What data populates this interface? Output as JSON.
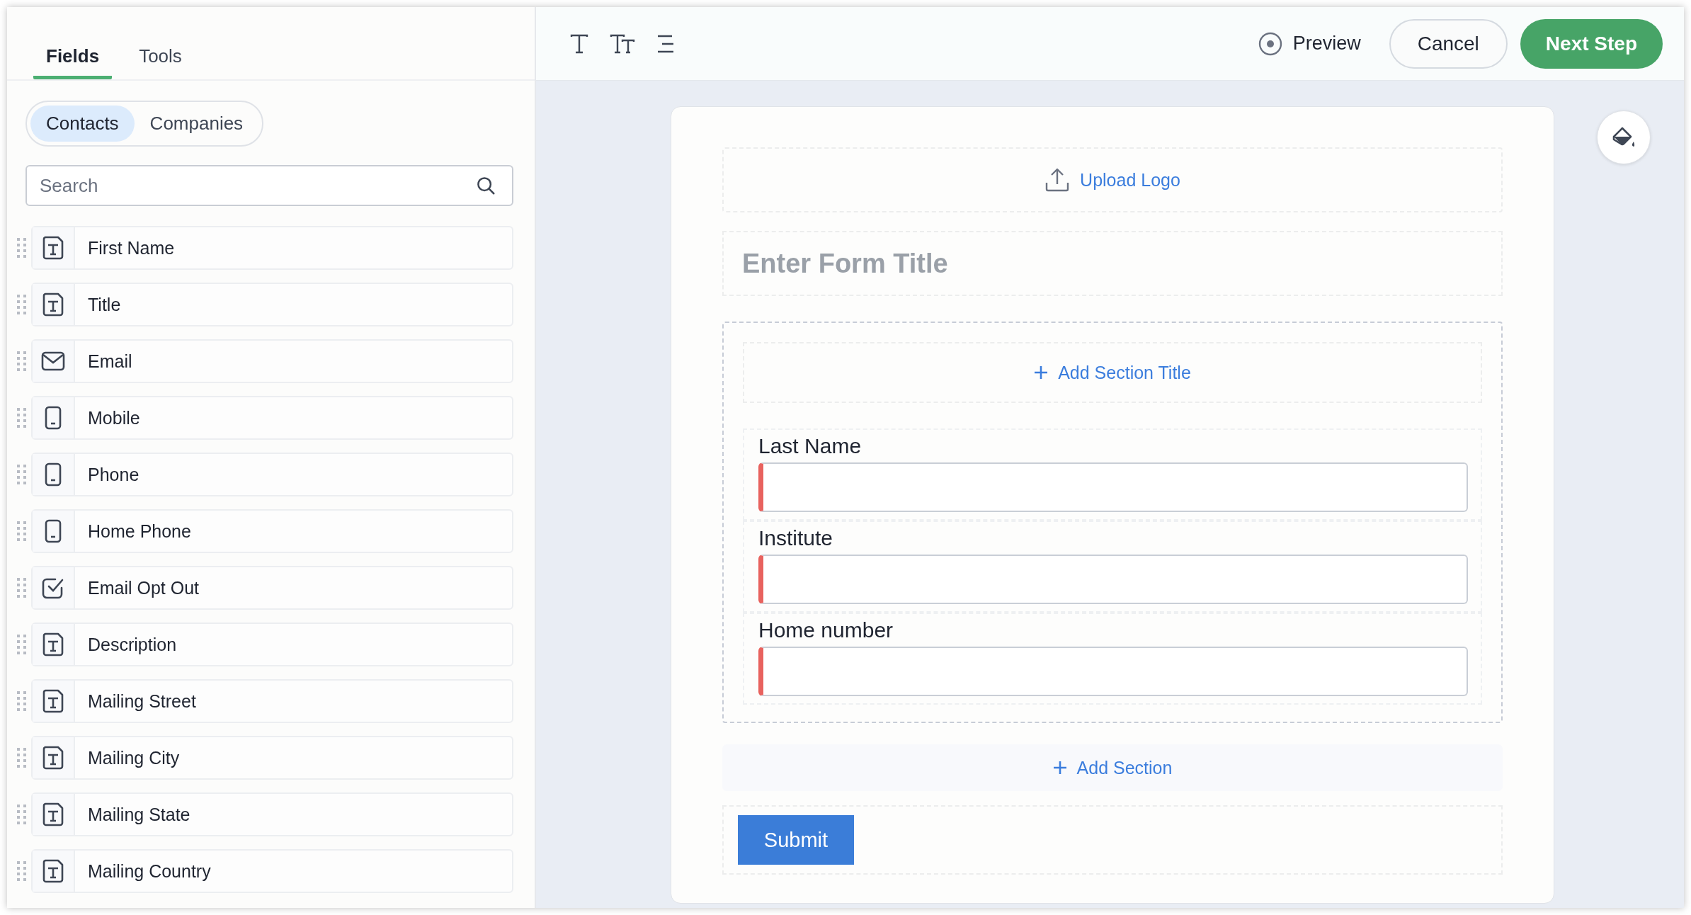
{
  "tabs": [
    {
      "label": "Fields",
      "selected": true
    },
    {
      "label": "Tools",
      "selected": false
    }
  ],
  "segments": [
    {
      "label": "Contacts",
      "selected": true
    },
    {
      "label": "Companies",
      "selected": false
    }
  ],
  "search": {
    "placeholder": "Search"
  },
  "fields": [
    {
      "label": "First Name",
      "kind": "text"
    },
    {
      "label": "Title",
      "kind": "text"
    },
    {
      "label": "Email",
      "kind": "email"
    },
    {
      "label": "Mobile",
      "kind": "phone"
    },
    {
      "label": "Phone",
      "kind": "phone"
    },
    {
      "label": "Home Phone",
      "kind": "phone"
    },
    {
      "label": "Email Opt Out",
      "kind": "checkbox"
    },
    {
      "label": "Description",
      "kind": "text"
    },
    {
      "label": "Mailing Street",
      "kind": "text"
    },
    {
      "label": "Mailing City",
      "kind": "text"
    },
    {
      "label": "Mailing State",
      "kind": "text"
    },
    {
      "label": "Mailing Country",
      "kind": "text"
    }
  ],
  "toolbar": {
    "preview": "Preview",
    "cancel": "Cancel",
    "next": "Next Step"
  },
  "form": {
    "upload_logo": "Upload Logo",
    "title": {
      "placeholder": "Enter Form Title"
    },
    "add_section_title": "Add Section Title",
    "fields": [
      {
        "label": "Last Name",
        "required": true
      },
      {
        "label": "Institute",
        "required": true
      },
      {
        "label": "Home number",
        "required": true
      }
    ],
    "add_section": "Add Section",
    "submit": "Submit"
  }
}
